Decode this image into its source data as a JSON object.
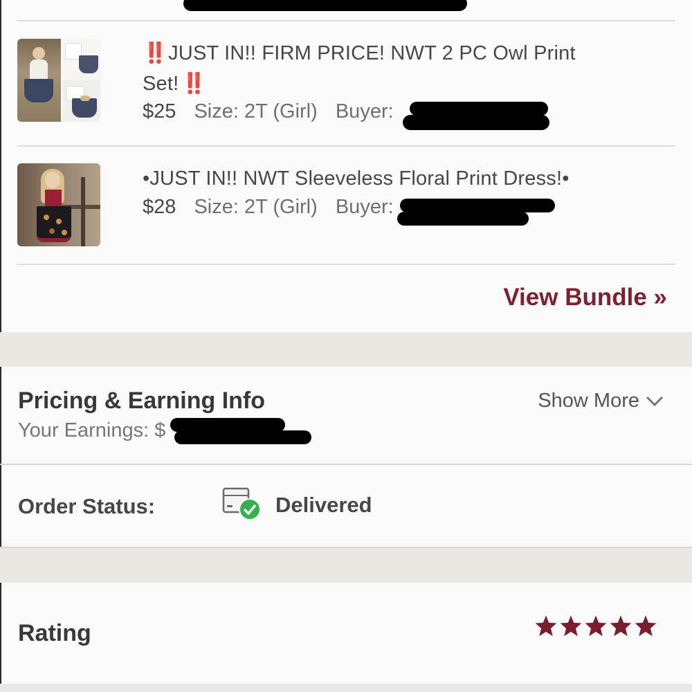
{
  "items": [
    {
      "title_prefix": "‼️",
      "title": "JUST IN!! FIRM PRICE! NWT 2 PC Owl Print Set!",
      "title_suffix": "‼️",
      "price": "$25",
      "size": "Size: 2T (Girl)",
      "buyer_label": "Buyer:",
      "thumbnail_icon": "owl-print-set-photo"
    },
    {
      "title": "•JUST IN!! NWT Sleeveless Floral Print Dress!•",
      "price": "$28",
      "size": "Size: 2T (Girl)",
      "buyer_label": "Buyer:",
      "thumbnail_icon": "floral-dress-photo"
    }
  ],
  "bundle": {
    "view_label": "View Bundle »"
  },
  "pricing": {
    "title": "Pricing & Earning Info",
    "earnings_label": "Your Earnings: $",
    "show_more_label": "Show More",
    "show_more_icon": "chevron-down-icon"
  },
  "order": {
    "label": "Order Status:",
    "value": "Delivered",
    "icon": "package-delivered-icon",
    "check_color": "#2fb34a"
  },
  "rating": {
    "label": "Rating",
    "stars": 5,
    "max_stars": 5,
    "star_color": "#7a1e2c"
  },
  "colors": {
    "accent": "#7f1f2f",
    "warning": "#e0231b"
  }
}
